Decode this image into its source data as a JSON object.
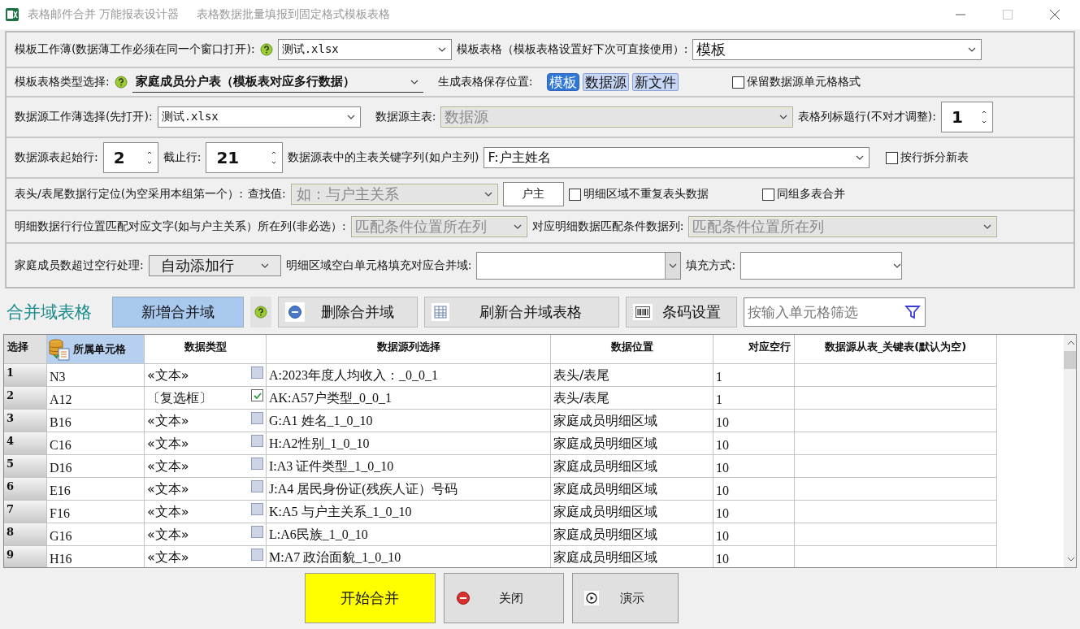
{
  "window": {
    "app_title": "表格邮件合并 万能报表设计器",
    "subtitle": "表格数据批量填报到固定格式模板表格"
  },
  "template_workbook": {
    "label": "模板工作薄(数据薄工作必须在同一个窗口打开):",
    "value": "测试.xlsx"
  },
  "template_sheet": {
    "label": "模板表格（模板表格设置好下次可直接使用）:",
    "value": "模板"
  },
  "template_type": {
    "label": "模板表格类型选择:",
    "value": "家庭成员分户表（模板表对应多行数据）"
  },
  "save_location": {
    "label": "生成表格保存位置:",
    "options": [
      {
        "label": "模板",
        "selected": true
      },
      {
        "label": "数据源",
        "selected": false
      },
      {
        "label": "新文件",
        "selected": false
      }
    ]
  },
  "keep_format": {
    "label": "保留数据源单元格格式",
    "checked": false
  },
  "source_workbook": {
    "label": "数据源工作薄选择(先打开):",
    "value": "测试.xlsx"
  },
  "source_main_sheet": {
    "label": "数据源主表:",
    "value": "数据源",
    "disabled": true
  },
  "header_row": {
    "label": "表格列标题行(不对才调整):",
    "value": "1"
  },
  "start_row": {
    "label": "数据源表起始行:",
    "value": "2"
  },
  "end_row": {
    "label": "截止行:",
    "value": "21"
  },
  "key_column": {
    "label": "数据源表中的主表关键字列(如户主列)",
    "value": "F:户主姓名"
  },
  "split_by_row": {
    "label": "按行拆分新表",
    "checked": false
  },
  "header_locate": {
    "label": "表头/表尾数据行定位(为空采用本组第一个）:",
    "search_label": "查找值:",
    "search_placeholder": "如：与户主关系",
    "disabled": true,
    "button": "户主"
  },
  "no_repeat_header": {
    "label": "明细区域不重复表头数据",
    "checked": false
  },
  "group_merge": {
    "label": "同组多表合并",
    "checked": false
  },
  "detail_match_column": {
    "label": "明细数据行行位置匹配对应文字(如与户主关系）所在列(非必选）:",
    "value": "匹配条件位置所在列",
    "disabled": true
  },
  "detail_data_column": {
    "label": "对应明细数据匹配条件数据列:",
    "value": "匹配条件位置所在列",
    "disabled": true
  },
  "overflow": {
    "label": "家庭成员数超过空行处理:",
    "value": "自动添加行"
  },
  "blank_fill": {
    "label": "明细区域空白单元格填充对应合并域:"
  },
  "fill_mode": {
    "label": "填充方式:"
  },
  "toolbar": {
    "title": "合并域表格",
    "add": "新增合并域",
    "delete": "删除合并域",
    "refresh": "刷新合并域表格",
    "barcode": "条码设置",
    "filter_placeholder": "按输入单元格筛选"
  },
  "table": {
    "columns": [
      "选择",
      "所属单元格",
      "数据类型",
      "数据源列选择",
      "数据位置",
      "对应空行",
      "数据源从表_关键表(默认为空)"
    ],
    "rows": [
      {
        "index": "1",
        "cell": "N3",
        "type": "«文本»",
        "checked": false,
        "source": "A:2023年度人均收入：_0_0_1",
        "position": "表头/表尾",
        "blank_rows": "1"
      },
      {
        "index": "2",
        "cell": "A12",
        "type": "〔复选框〕",
        "checked": true,
        "source": "AK:A57户类型_0_0_1",
        "position": "表头/表尾",
        "blank_rows": "1"
      },
      {
        "index": "3",
        "cell": "B16",
        "type": "«文本»",
        "checked": false,
        "source": "G:A1 姓名_1_0_10",
        "position": "家庭成员明细区域",
        "blank_rows": "10"
      },
      {
        "index": "4",
        "cell": "C16",
        "type": "«文本»",
        "checked": false,
        "source": "H:A2性别_1_0_10",
        "position": "家庭成员明细区域",
        "blank_rows": "10"
      },
      {
        "index": "5",
        "cell": "D16",
        "type": "«文本»",
        "checked": false,
        "source": "I:A3 证件类型_1_0_10",
        "position": "家庭成员明细区域",
        "blank_rows": "10"
      },
      {
        "index": "6",
        "cell": "E16",
        "type": "«文本»",
        "checked": false,
        "source": "J:A4 居民身份证(残疾人证）号码",
        "position": "家庭成员明细区域",
        "blank_rows": "10"
      },
      {
        "index": "7",
        "cell": "F16",
        "type": "«文本»",
        "checked": false,
        "source": "K:A5 与户主关系_1_0_10",
        "position": "家庭成员明细区域",
        "blank_rows": "10"
      },
      {
        "index": "8",
        "cell": "G16",
        "type": "«文本»",
        "checked": false,
        "source": "L:A6民族_1_0_10",
        "position": "家庭成员明细区域",
        "blank_rows": "10"
      },
      {
        "index": "9",
        "cell": "H16",
        "type": "«文本»",
        "checked": false,
        "source": "M:A7 政治面貌_1_0_10",
        "position": "家庭成员明细区域",
        "blank_rows": "10"
      }
    ]
  },
  "footer": {
    "start": "开始合并",
    "close": "关闭",
    "demo": "演示"
  }
}
